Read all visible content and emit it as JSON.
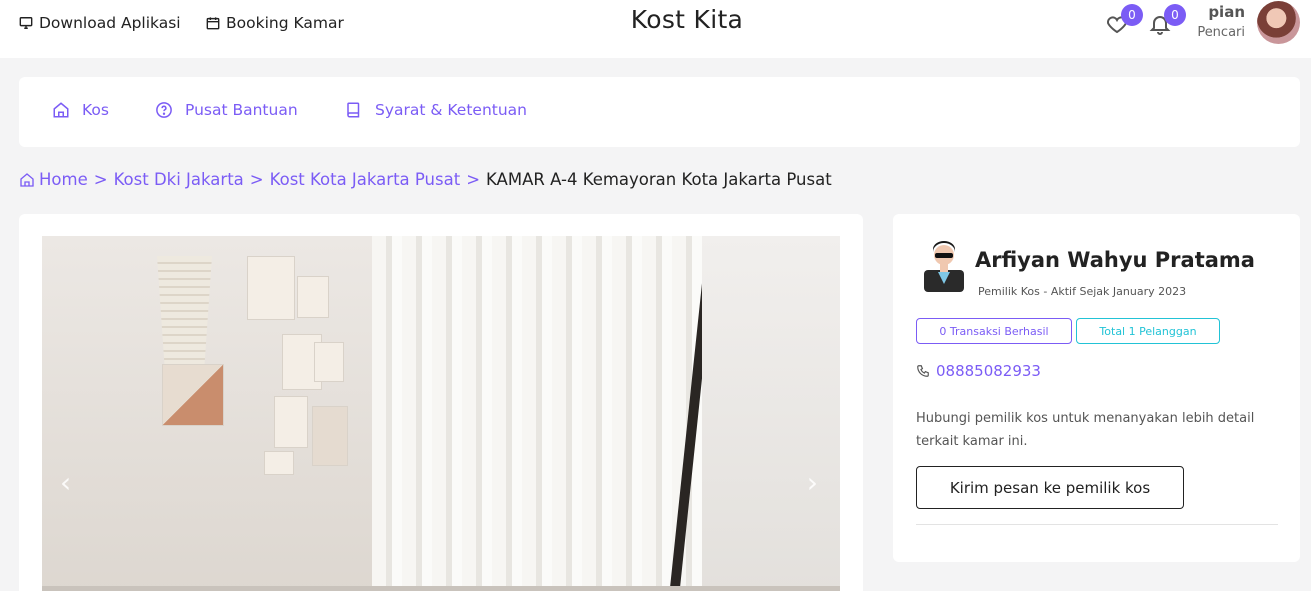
{
  "topbar": {
    "download_label": "Download Aplikasi",
    "booking_label": "Booking Kamar",
    "brand": "Kost Kita",
    "wishlist_count": "0",
    "notif_count": "0",
    "user_name": "pian",
    "user_role": "Pencari"
  },
  "nav": {
    "items": [
      {
        "label": "Kos",
        "icon": "home-icon"
      },
      {
        "label": "Pusat Bantuan",
        "icon": "help-circle-icon"
      },
      {
        "label": "Syarat & Ketentuan",
        "icon": "book-icon"
      }
    ]
  },
  "breadcrumb": {
    "items": [
      "Home",
      "Kost Dki Jakarta",
      "Kost Kota Jakarta Pusat"
    ],
    "separator": ">",
    "current": "KAMAR A-4 Kemayoran Kota Jakarta Pusat"
  },
  "gallery": {
    "prev": "‹",
    "next": "›"
  },
  "owner": {
    "name": "Arfiyan Wahyu Pratama",
    "subtitle": "Pemilik Kos - Aktif Sejak January 2023",
    "transactions": "0 Transaksi Berhasil",
    "customers": "Total 1 Pelanggan",
    "phone": "08885082933",
    "description": "Hubungi pemilik kos untuk menanyakan lebih detail terkait kamar ini.",
    "message_button": "Kirim pesan ke pemilik kos"
  },
  "colors": {
    "accent": "#7b5cf5",
    "teal": "#22c3d6"
  }
}
